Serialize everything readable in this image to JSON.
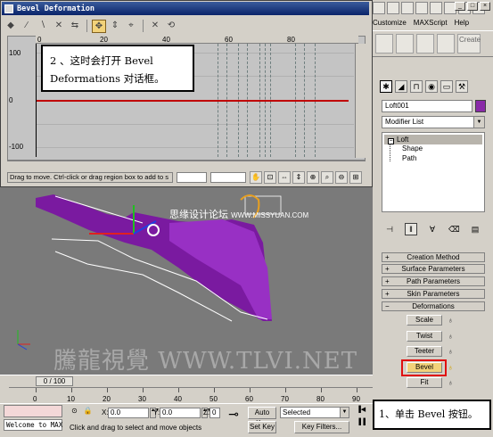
{
  "dialog": {
    "title": "Bevel Deformation",
    "ruler_ticks": [
      "0",
      "20",
      "40",
      "60",
      "80"
    ],
    "y_ticks": [
      "100",
      "0",
      "-100"
    ],
    "status": "Drag to move. Ctrl-click or drag region box to add to s"
  },
  "tips": {
    "tip2_line1": "2 、这时会打开 Bevel",
    "tip2_line2": "Deformations 对话框。",
    "tip1": "1、单击 Bevel 按钮。"
  },
  "main_menu": {
    "items": [
      "Customize",
      "MAXScript",
      "Help"
    ],
    "create_label": "Create"
  },
  "command_panel": {
    "object_name": "Loft001",
    "modifier_list": "Modifier List",
    "stack": {
      "root": "Loft",
      "children": [
        "Shape",
        "Path"
      ]
    },
    "rollouts": [
      "Creation Method",
      "Surface Parameters",
      "Path Parameters",
      "Skin Parameters",
      "Deformations"
    ],
    "deformations": [
      "Scale",
      "Twist",
      "Teeter",
      "Bevel",
      "Fit"
    ],
    "color": "#8a2aa8"
  },
  "viewport": {
    "watermark": "騰龍視覺 WWW.TLVI.NET",
    "watermark2": "思缘设计论坛",
    "watermark2_url": "WWW.MISSYUAN.COM"
  },
  "timeline": {
    "slider": "0 / 100",
    "ticks": [
      "0",
      "10",
      "20",
      "30",
      "40",
      "50",
      "60",
      "70",
      "80",
      "90"
    ]
  },
  "status": {
    "welcome": "Welcome to MAX",
    "prompt": "Click and drag to select and move objects",
    "x_label": "X:",
    "y_label": "Y:",
    "z_label": "Z:",
    "x_value": "0.0",
    "y_value": "0.0",
    "z_value": "0",
    "auto_key": "Auto Key",
    "set_key": "Set Key",
    "selected": "Selected",
    "key_filters": "Key Filters..."
  }
}
